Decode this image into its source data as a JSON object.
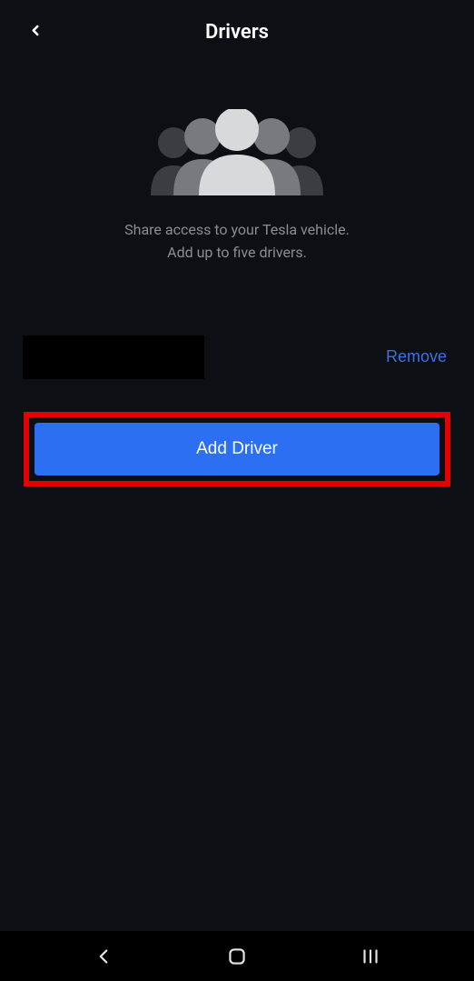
{
  "header": {
    "title": "Drivers"
  },
  "hero": {
    "description_line1": "Share access to your Tesla vehicle.",
    "description_line2": "Add up to five drivers."
  },
  "drivers": {
    "remove_label": "Remove"
  },
  "actions": {
    "add_driver_label": "Add Driver"
  },
  "colors": {
    "accent": "#2c6ff2",
    "highlight": "#e60000"
  }
}
